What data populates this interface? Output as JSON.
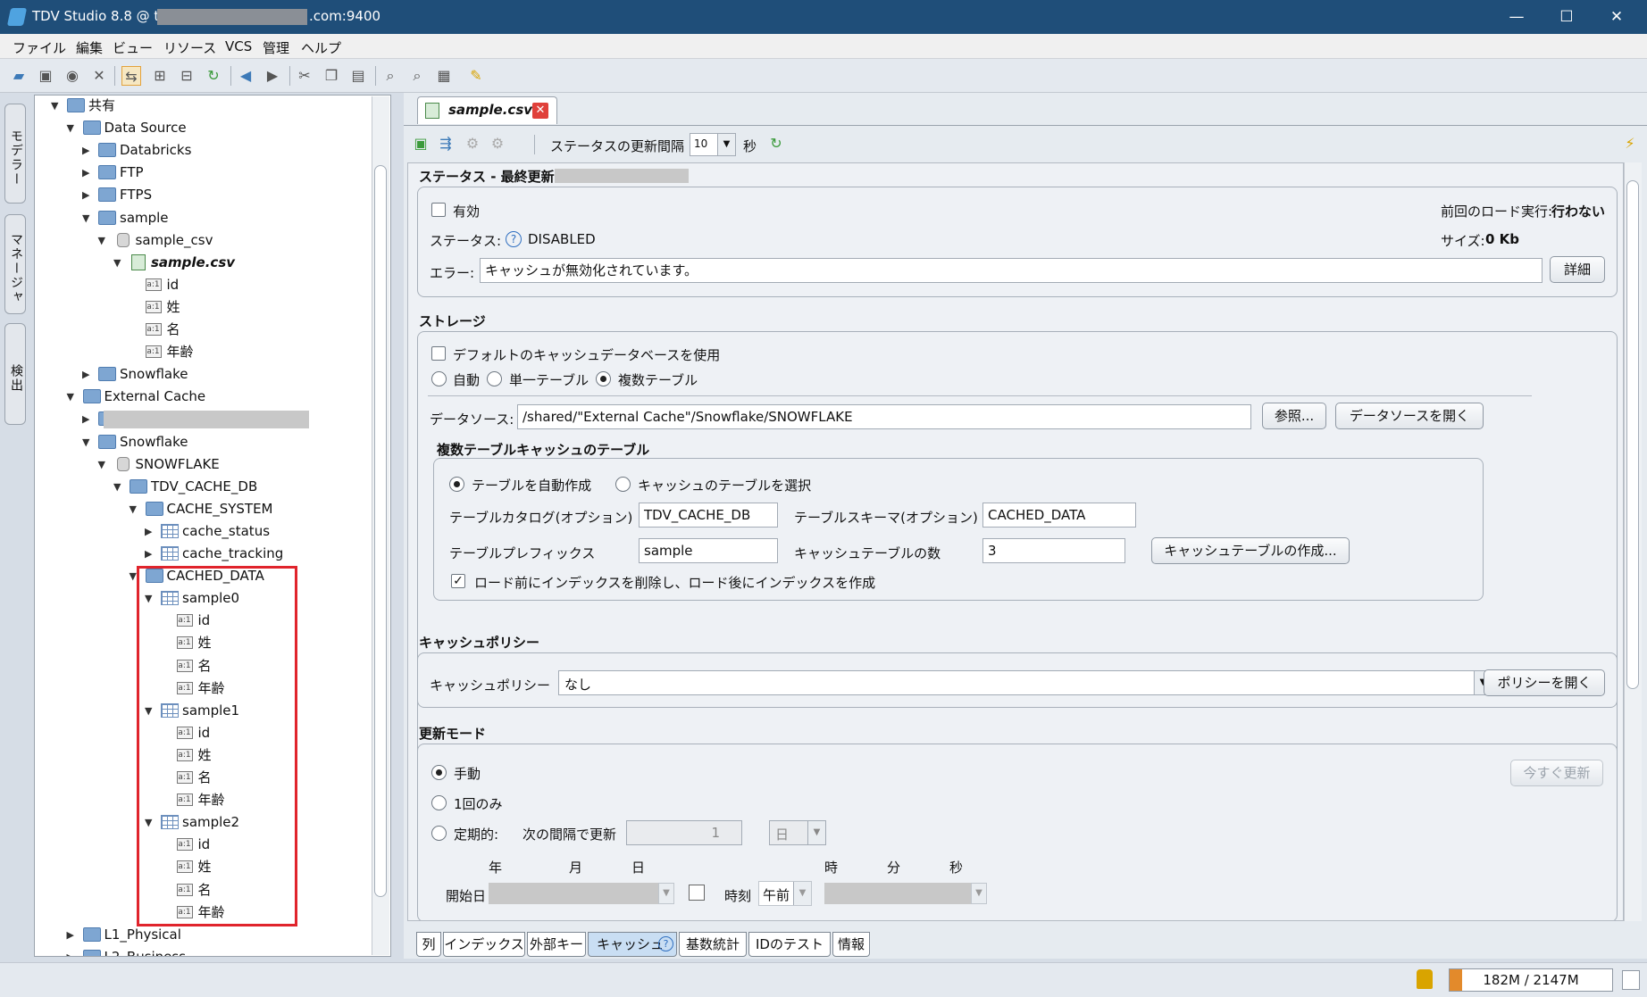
{
  "window": {
    "title": "TDV Studio 8.8 @ tdv",
    "title_suffix": ".com:9400",
    "min": "—",
    "max": "☐",
    "close": "✕"
  },
  "menu": [
    "ファイル",
    "編集",
    "ビュー",
    "リソース",
    "VCS",
    "管理",
    "ヘルプ"
  ],
  "sidetabs": [
    "モデラー",
    "マネージャ",
    "検出"
  ],
  "tree": [
    {
      "label": "共有",
      "indent": 0,
      "icon": "shared",
      "arrow": "▼"
    },
    {
      "label": "Data Source",
      "indent": 1,
      "icon": "folder",
      "arrow": "▼"
    },
    {
      "label": "Databricks",
      "indent": 2,
      "icon": "folder",
      "arrow": "▶"
    },
    {
      "label": "FTP",
      "indent": 2,
      "icon": "folder",
      "arrow": "▶"
    },
    {
      "label": "FTPS",
      "indent": 2,
      "icon": "folder",
      "arrow": "▶"
    },
    {
      "label": "sample",
      "indent": 2,
      "icon": "folder",
      "arrow": "▼"
    },
    {
      "label": "sample_csv",
      "indent": 3,
      "icon": "db",
      "arrow": "▼"
    },
    {
      "label": "sample.csv",
      "indent": 4,
      "icon": "csv",
      "arrow": "▼",
      "bold": true
    },
    {
      "label": "id",
      "indent": 5,
      "icon": "col",
      "arrow": ""
    },
    {
      "label": "姓",
      "indent": 5,
      "icon": "col",
      "arrow": ""
    },
    {
      "label": "名",
      "indent": 5,
      "icon": "col",
      "arrow": ""
    },
    {
      "label": "年齢",
      "indent": 5,
      "icon": "col",
      "arrow": ""
    },
    {
      "label": "Snowflake",
      "indent": 2,
      "icon": "folder",
      "arrow": "▶"
    },
    {
      "label": "External Cache",
      "indent": 1,
      "icon": "folder",
      "arrow": "▼"
    },
    {
      "label": "",
      "indent": 2,
      "icon": "folder",
      "arrow": "▶",
      "redacted": true
    },
    {
      "label": "Snowflake",
      "indent": 2,
      "icon": "folder",
      "arrow": "▼"
    },
    {
      "label": "SNOWFLAKE",
      "indent": 3,
      "icon": "db",
      "arrow": "▼"
    },
    {
      "label": "TDV_CACHE_DB",
      "indent": 4,
      "icon": "folder",
      "arrow": "▼"
    },
    {
      "label": "CACHE_SYSTEM",
      "indent": 5,
      "icon": "folder",
      "arrow": "▼"
    },
    {
      "label": "cache_status",
      "indent": 6,
      "icon": "table",
      "arrow": "▶"
    },
    {
      "label": "cache_tracking",
      "indent": 6,
      "icon": "table",
      "arrow": "▶"
    },
    {
      "label": "CACHED_DATA",
      "indent": 5,
      "icon": "folder",
      "arrow": "▼"
    },
    {
      "label": "sample0",
      "indent": 6,
      "icon": "table",
      "arrow": "▼"
    },
    {
      "label": "id",
      "indent": 7,
      "icon": "col",
      "arrow": ""
    },
    {
      "label": "姓",
      "indent": 7,
      "icon": "col",
      "arrow": ""
    },
    {
      "label": "名",
      "indent": 7,
      "icon": "col",
      "arrow": ""
    },
    {
      "label": "年齢",
      "indent": 7,
      "icon": "col",
      "arrow": ""
    },
    {
      "label": "sample1",
      "indent": 6,
      "icon": "table",
      "arrow": "▼"
    },
    {
      "label": "id",
      "indent": 7,
      "icon": "col",
      "arrow": ""
    },
    {
      "label": "姓",
      "indent": 7,
      "icon": "col",
      "arrow": ""
    },
    {
      "label": "名",
      "indent": 7,
      "icon": "col",
      "arrow": ""
    },
    {
      "label": "年齢",
      "indent": 7,
      "icon": "col",
      "arrow": ""
    },
    {
      "label": "sample2",
      "indent": 6,
      "icon": "table",
      "arrow": "▼"
    },
    {
      "label": "id",
      "indent": 7,
      "icon": "col",
      "arrow": ""
    },
    {
      "label": "姓",
      "indent": 7,
      "icon": "col",
      "arrow": ""
    },
    {
      "label": "名",
      "indent": 7,
      "icon": "col",
      "arrow": ""
    },
    {
      "label": "年齢",
      "indent": 7,
      "icon": "col",
      "arrow": ""
    },
    {
      "label": "L1_Physical",
      "indent": 1,
      "icon": "folder",
      "arrow": "▶"
    },
    {
      "label": "L2_Business",
      "indent": 1,
      "icon": "folder",
      "arrow": "▶"
    }
  ],
  "editor": {
    "tab": "sample.csv",
    "refresh_label": "ステータスの更新間隔",
    "refresh_value": "10",
    "refresh_unit": "秒",
    "status": {
      "header": "ステータス - 最終更新:",
      "enabled_label": "有効",
      "last_load_label": "前回のロード実行:",
      "last_load_value": "行わない",
      "status_label": "ステータス:",
      "status_value": "DISABLED",
      "size_label": "サイズ:",
      "size_value": "0 Kb",
      "error_label": "エラー:",
      "error_value": "キャッシュが無効化されています。",
      "detail_btn": "詳細"
    },
    "storage": {
      "header": "ストレージ",
      "use_default": "デフォルトのキャッシュデータベースを使用",
      "radio_auto": "自動",
      "radio_single": "単一テーブル",
      "radio_multi": "複数テーブル",
      "ds_label": "データソース:",
      "ds_value": "/shared/\"External Cache\"/Snowflake/SNOWFLAKE",
      "browse_btn": "参照...",
      "open_ds_btn": "データソースを開く",
      "multi_header": "複数テーブルキャッシュのテーブル",
      "auto_create": "テーブルを自動作成",
      "select_tables": "キャッシュのテーブルを選択",
      "catalog_label": "テーブルカタログ(オプション)",
      "catalog_value": "TDV_CACHE_DB",
      "schema_label": "テーブルスキーマ(オプション)",
      "schema_value": "CACHED_DATA",
      "prefix_label": "テーブルプレフィックス",
      "prefix_value": "sample",
      "count_label": "キャッシュテーブルの数",
      "count_value": "3",
      "create_btn": "キャッシュテーブルの作成...",
      "index_opt": "ロード前にインデックスを削除し、ロード後にインデックスを作成"
    },
    "policy": {
      "header": "キャッシュポリシー",
      "label": "キャッシュポリシー",
      "value": "なし",
      "open_btn": "ポリシーを開く"
    },
    "refresh": {
      "header": "更新モード",
      "manual": "手動",
      "once": "1回のみ",
      "periodic": "定期的:",
      "interval_label": "次の間隔で更新",
      "interval_value": "1",
      "interval_unit": "日",
      "now_btn": "今すぐ更新",
      "col_year": "年",
      "col_month": "月",
      "col_day": "日",
      "col_hour": "時",
      "col_min": "分",
      "col_sec": "秒",
      "start_label": "開始日",
      "time_label": "時刻",
      "ampm": "午前"
    }
  },
  "bottom_tabs": [
    "列",
    "インデックス",
    "外部キー",
    "キャッシュ",
    "基数統計",
    "IDのテスト",
    "情報"
  ],
  "memory": "182M / 2147M",
  "colors": {
    "titlebar": "#1f4e79",
    "highlight": "#e0242c",
    "memfill": "#e38a2b"
  }
}
